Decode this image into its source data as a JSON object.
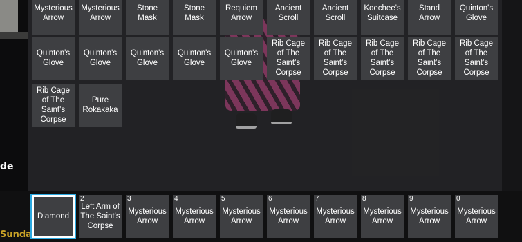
{
  "hud": {
    "side_text": "de",
    "day_text": "Sunday"
  },
  "inventory": [
    "Mysterious Arrow",
    "Mysterious Arrow",
    "Stone Mask",
    "Stone Mask",
    "Requiem Arrow",
    "Ancient Scroll",
    "Ancient Scroll",
    "Koechee's Suitcase",
    "Stand Arrow",
    "Quinton's Glove",
    "Quinton's Glove",
    "Quinton's Glove",
    "Quinton's Glove",
    "Quinton's Glove",
    "Quinton's Glove",
    "Rib Cage of The Saint's Corpse",
    "Rib Cage of The Saint's Corpse",
    "Rib Cage of The Saint's Corpse",
    "Rib Cage of The Saint's Corpse",
    "Rib Cage of The Saint's Corpse",
    "Rib Cage of The Saint's Corpse",
    "Pure Rokakaka"
  ],
  "hotbar": [
    {
      "key": "",
      "label": "Diamond",
      "selected": true
    },
    {
      "key": "2",
      "label": "Left Arm of The Saint's Corpse"
    },
    {
      "key": "3",
      "label": "Mysterious Arrow"
    },
    {
      "key": "4",
      "label": "Mysterious Arrow"
    },
    {
      "key": "5",
      "label": "Mysterious Arrow"
    },
    {
      "key": "6",
      "label": "Mysterious Arrow"
    },
    {
      "key": "7",
      "label": "Mysterious Arrow"
    },
    {
      "key": "8",
      "label": "Mysterious Arrow"
    },
    {
      "key": "9",
      "label": "Mysterious Arrow"
    },
    {
      "key": "0",
      "label": "Mysterious Arrow"
    }
  ]
}
